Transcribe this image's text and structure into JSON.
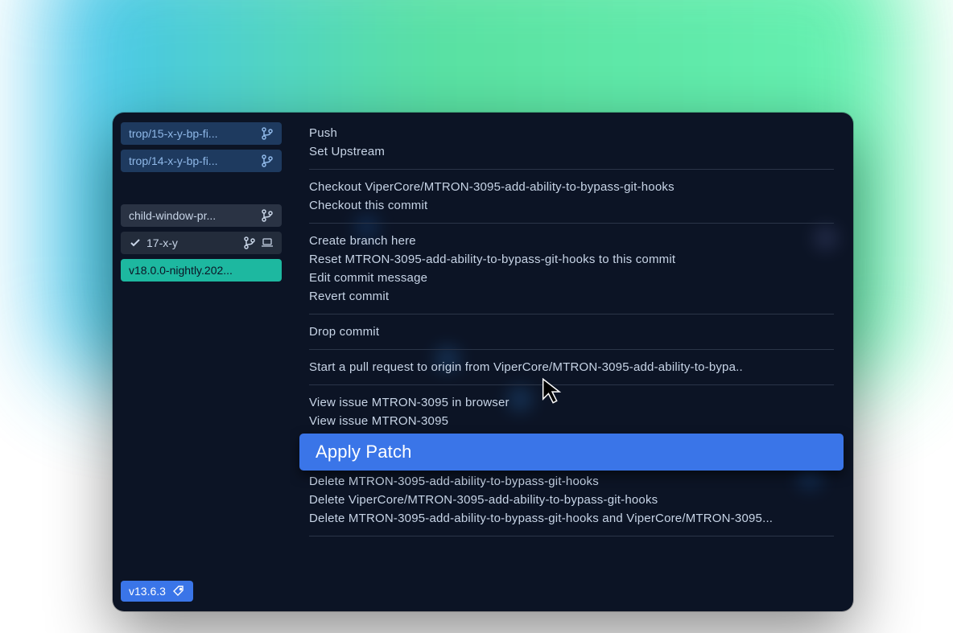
{
  "sidebar": {
    "branches": [
      {
        "label": "trop/15-x-y-bp-fi...",
        "style": "bb-blue",
        "icons": [
          "git"
        ]
      },
      {
        "label": "trop/14-x-y-bp-fi...",
        "style": "bb-blue",
        "icons": [
          "git"
        ]
      },
      {
        "label": "child-window-pr...",
        "style": "bb-dark",
        "icons": [
          "git"
        ]
      },
      {
        "label": "17-x-y",
        "style": "bb-darker",
        "icons": [
          "check",
          "git",
          "laptop"
        ]
      },
      {
        "label": "v18.0.0-nightly.202...",
        "style": "bb-teal",
        "icons": []
      }
    ]
  },
  "version": {
    "label": "v13.6.3"
  },
  "menu": {
    "groups": [
      {
        "items": [
          "Push",
          "Set Upstream"
        ]
      },
      {
        "items": [
          "Checkout ViperCore/MTRON-3095-add-ability-to-bypass-git-hooks",
          "Checkout this commit"
        ]
      },
      {
        "items": [
          "Create branch here",
          "Reset MTRON-3095-add-ability-to-bypass-git-hooks to this commit",
          "Edit commit message",
          "Revert commit"
        ]
      },
      {
        "items": [
          "Drop commit"
        ]
      },
      {
        "items": [
          "Start a pull request to origin from ViperCore/MTRON-3095-add-ability-to-bypa.."
        ]
      },
      {
        "items": [
          "View issue MTRON-3095 in browser",
          "View issue MTRON-3095"
        ]
      },
      {
        "items": [
          "Apply Patch",
          "Delete MTRON-3095-add-ability-to-bypass-git-hooks",
          "Delete ViperCore/MTRON-3095-add-ability-to-bypass-git-hooks",
          "Delete MTRON-3095-add-ability-to-bypass-git-hooks and ViperCore/MTRON-3095..."
        ],
        "highlighted": 0
      }
    ]
  }
}
